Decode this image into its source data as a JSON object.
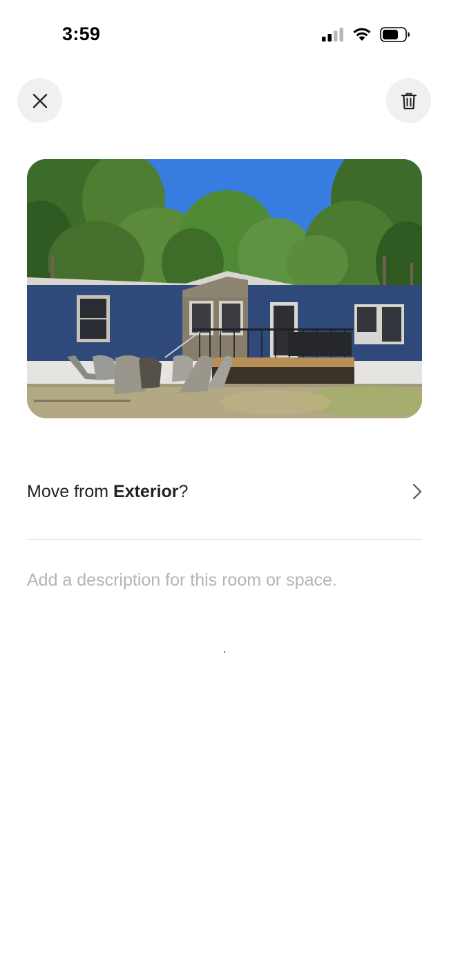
{
  "status_bar": {
    "time": "3:59",
    "signal_icon": "cellular-signal-icon",
    "wifi_icon": "wifi-icon",
    "battery_icon": "battery-icon"
  },
  "header": {
    "close_icon": "close-icon",
    "delete_icon": "trash-icon"
  },
  "photo": {
    "subject": "exterior-house-photo"
  },
  "move_row": {
    "prefix": "Move from ",
    "room": "Exterior",
    "suffix": "?",
    "chevron_icon": "chevron-right-icon"
  },
  "description": {
    "value": "",
    "placeholder": "Add a description for this room or space."
  },
  "colors": {
    "button_bg": "#f0f0f0",
    "text": "#222222",
    "placeholder": "#b4b4b4",
    "divider": "#dddddd"
  }
}
